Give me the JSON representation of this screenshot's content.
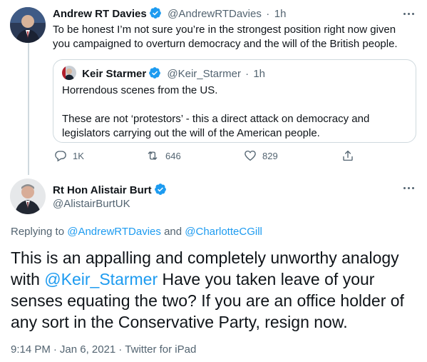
{
  "reply_tweet": {
    "author_name": "Andrew RT Davies",
    "author_handle": "@AndrewRTDavies",
    "dot": "·",
    "time": "1h",
    "text": "To be honest I’m not sure you’re in the strongest position right now given you campaigned to overturn democracy and the will of the British people.",
    "quoted": {
      "author_name": "Keir Starmer",
      "author_handle": "@Keir_Starmer",
      "dot": "·",
      "time": "1h",
      "paragraphs": [
        "Horrendous scenes from the US.",
        "These are not ‘protestors’ - this a direct attack on democracy and legislators carrying out the will of the American people."
      ]
    },
    "actions": {
      "replies": "1K",
      "retweets": "646",
      "likes": "829"
    }
  },
  "main_tweet": {
    "author_name": "Rt Hon Alistair Burt",
    "author_handle": "@AlistairBurtUK",
    "replying_prefix": "Replying to",
    "replying_to_1": "@AndrewRTDavies",
    "replying_and": "and",
    "replying_to_2": "@CharlotteCGill",
    "text_before_mention": "This is an appalling and completely unworthy analogy with",
    "mention": "@Keir_Starmer",
    "text_after_mention": "Have you taken leave of your senses equating the two? If you are an office holder of any sort in the Conservative Party, resign now.",
    "time": "9:14 PM",
    "date": "Jan 6, 2021",
    "dot": "·",
    "source": "Twitter for iPad"
  },
  "colors": {
    "accent": "#1d9bf0",
    "text": "#0f1419",
    "muted": "#536471",
    "border": "#cfd9de"
  }
}
